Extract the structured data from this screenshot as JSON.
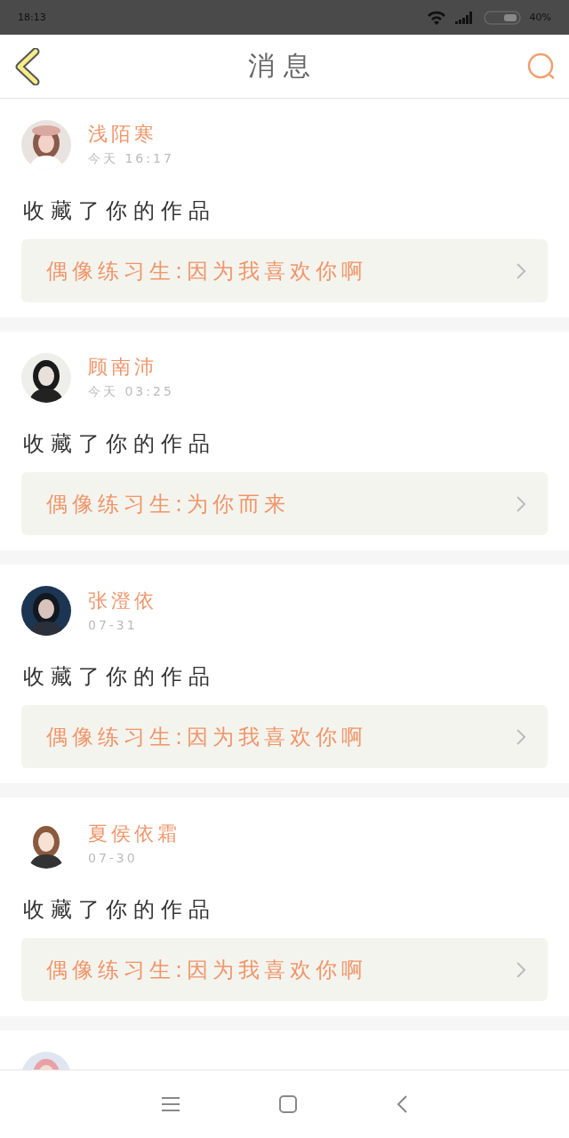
{
  "status_bar": {
    "time": "18:13",
    "battery": "40%"
  },
  "header": {
    "title": "消息"
  },
  "messages": [
    {
      "name": "浅陌寒",
      "time": "今天 16:17",
      "action": "收藏了你的作品",
      "work": "偶像练习生:因为我喜欢你啊",
      "avatar": {
        "kind": "picture"
      }
    },
    {
      "name": "顾南沛",
      "time": "今天 03:25",
      "action": "收藏了你的作品",
      "work": "偶像练习生:为你而来",
      "avatar": {
        "kind": "picture"
      }
    },
    {
      "name": "张澄依",
      "time": "07-31",
      "action": "收藏了你的作品",
      "work": "偶像练习生:因为我喜欢你啊",
      "avatar": {
        "kind": "picture"
      }
    },
    {
      "name": "夏侯依霜",
      "time": "07-30",
      "action": "收藏了你的作品",
      "work": "偶像练习生:因为我喜欢你啊",
      "avatar": {
        "kind": "picture"
      }
    },
    {
      "avatar": {
        "kind": "picture"
      }
    }
  ]
}
